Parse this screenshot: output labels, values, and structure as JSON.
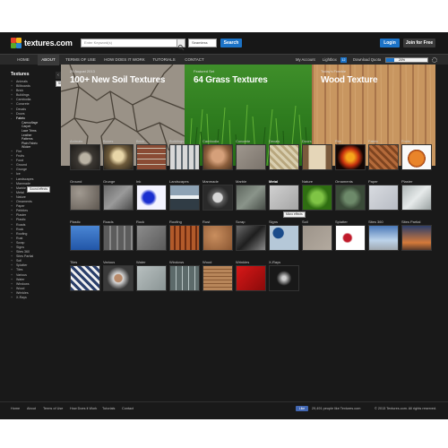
{
  "header": {
    "logo_text": "textures.com",
    "search_placeholder": "Enter Keyword(s)",
    "search_type": "Seamless",
    "search_button": "Search",
    "login_button": "Login",
    "join_button": "Join for Free"
  },
  "nav": {
    "items": [
      "HOME",
      "ABOUT",
      "TERMS OF USE",
      "HOW DOES IT WORK",
      "TUTORIALS",
      "CONTACT"
    ],
    "active": "ABOUT",
    "my_account": "My Account",
    "lightbox": "Lightbox",
    "lightbox_count": "12",
    "download_quota": "Download Quota",
    "quota_label": "20%",
    "quota_fraction": 0.2
  },
  "sidebar": {
    "title": "Textures",
    "categories_top": [
      "Animals",
      "Billboards",
      "Brick",
      "Buildings",
      "Cambodia",
      "Concrete",
      "Decals",
      "Doors"
    ],
    "open_category": "Fabric",
    "subcategories": [
      "Camouflage",
      "Carpet",
      "Lace Trims",
      "Leather",
      "Patterns",
      "Plain Fabric",
      "Wicker"
    ],
    "categories_bottom": [
      "Fire",
      "Fruits",
      "Food",
      "Ground",
      "Grunge",
      "Ice",
      "Landscapes",
      "Manmade",
      "Marble",
      "Metal",
      "Nature",
      "Ornaments",
      "Paper",
      "Pebbles",
      "Plaster",
      "Plastic",
      "Roads",
      "Rock",
      "Roofing",
      "Rust",
      "Scrap",
      "Signs",
      "Sites 360",
      "Sites Partial",
      "Soil",
      "Splatter",
      "Tiles",
      "Various",
      "Water",
      "Windows",
      "Wood",
      "Wrinkles",
      "X-Rays"
    ],
    "tooltip_show": "Show details",
    "tooltip_sub": "Sound effects"
  },
  "banners": [
    {
      "small": "29 August 2013",
      "title": "100+ New Soil Textures"
    },
    {
      "small": "Featured Set",
      "title": "64 Grass Textures"
    },
    {
      "small": "Today's Freebie",
      "title": "Wood Texture"
    }
  ],
  "grid_tooltip": "Micro effects",
  "categories": [
    "Animals",
    "Bones",
    "Brick",
    "Buildings",
    "Cambodia",
    "Concrete",
    "Decals",
    "Doors",
    "Fire",
    "Fabric",
    "Fruits",
    "Ground",
    "Grunge",
    "Ink",
    "Landscapes",
    "Manmade",
    "Marble",
    "Metal",
    "Nature",
    "Ornaments",
    "Paper",
    "Plaster",
    "Plastic",
    "Roads",
    "Rock",
    "Roofing",
    "Rust",
    "Scrap",
    "Signs",
    "Soil",
    "Splatter",
    "Sites 360",
    "Sites Partial",
    "Tiles",
    "Various",
    "Water",
    "Windows",
    "Wood",
    "Wrinkles",
    "X-Rays"
  ],
  "highlighted_category": "Metal",
  "footer": {
    "links": [
      "Home",
      "About",
      "Terms of Use",
      "How Does it Work",
      "Tutorials",
      "Contact"
    ],
    "like": "Like",
    "like_text": "29,491 people like Textures.com",
    "copyright": "© 2013 Textures.com. All rights reserved."
  },
  "colors": {
    "accent": "#1c73c7",
    "background": "#191919",
    "header": "#171717"
  }
}
